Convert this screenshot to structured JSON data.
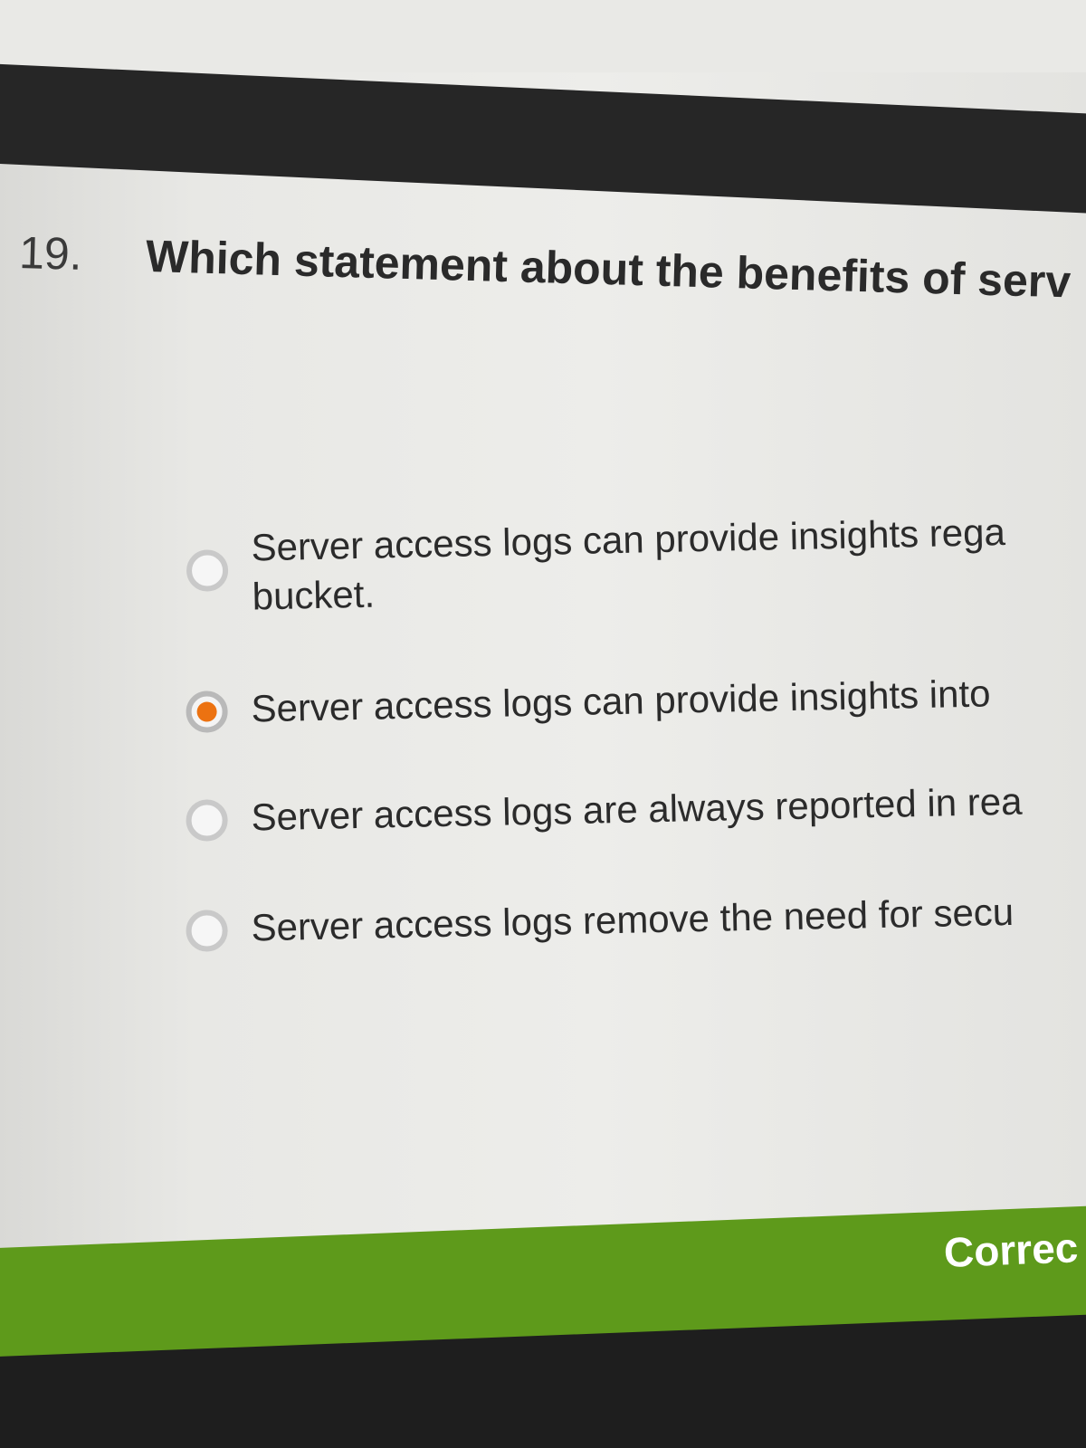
{
  "question": {
    "number": "19.",
    "text": "Which statement about the benefits of serv"
  },
  "options": [
    {
      "line1": "Server access logs can provide insights rega",
      "line2": "bucket.",
      "selected": false
    },
    {
      "line1": "Server access logs can provide insights into",
      "selected": true
    },
    {
      "line1": "Server access logs are always reported in rea",
      "selected": false
    },
    {
      "line1": "Server access logs remove the need for secu",
      "selected": false
    }
  ],
  "feedback": {
    "label": "Correc",
    "color": "#5e9a1b"
  },
  "colors": {
    "accent": "#ec7211"
  }
}
